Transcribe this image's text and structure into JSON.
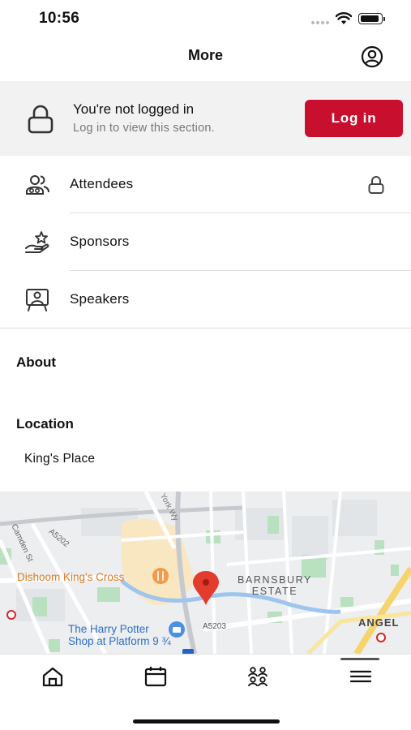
{
  "status_bar": {
    "time": "10:56"
  },
  "header": {
    "title": "More",
    "profile_icon": "profile-circle-icon"
  },
  "login_banner": {
    "title": "You're not logged in",
    "subtitle": "Log in to view this section.",
    "button_label": "Log in",
    "accent_color": "#c8102e"
  },
  "menu": {
    "items": [
      {
        "label": "Attendees",
        "icon": "attendees-icon",
        "locked": true
      },
      {
        "label": "Sponsors",
        "icon": "sponsors-icon",
        "locked": false
      },
      {
        "label": "Speakers",
        "icon": "speakers-icon",
        "locked": false
      }
    ]
  },
  "sections": {
    "about": "About",
    "location": "Location",
    "location_name": "King's Place"
  },
  "map": {
    "labels": {
      "dishoom": "Dishoom King's Cross",
      "potter_line1": "The Harry Potter",
      "potter_line2": "Shop at Platform 9 ¾",
      "barnsbury_line1": "BARNSBURY",
      "barnsbury_line2": "ESTATE",
      "angel": "ANGEL",
      "a5203": "A5203",
      "a5202": "A5202",
      "camden": "Camden St",
      "york": "York Wy"
    }
  },
  "tab_bar": {
    "tabs": [
      {
        "name": "home",
        "icon": "home-icon"
      },
      {
        "name": "calendar",
        "icon": "calendar-icon"
      },
      {
        "name": "people",
        "icon": "people-icon"
      },
      {
        "name": "menu",
        "icon": "menu-icon",
        "active": true
      }
    ]
  }
}
